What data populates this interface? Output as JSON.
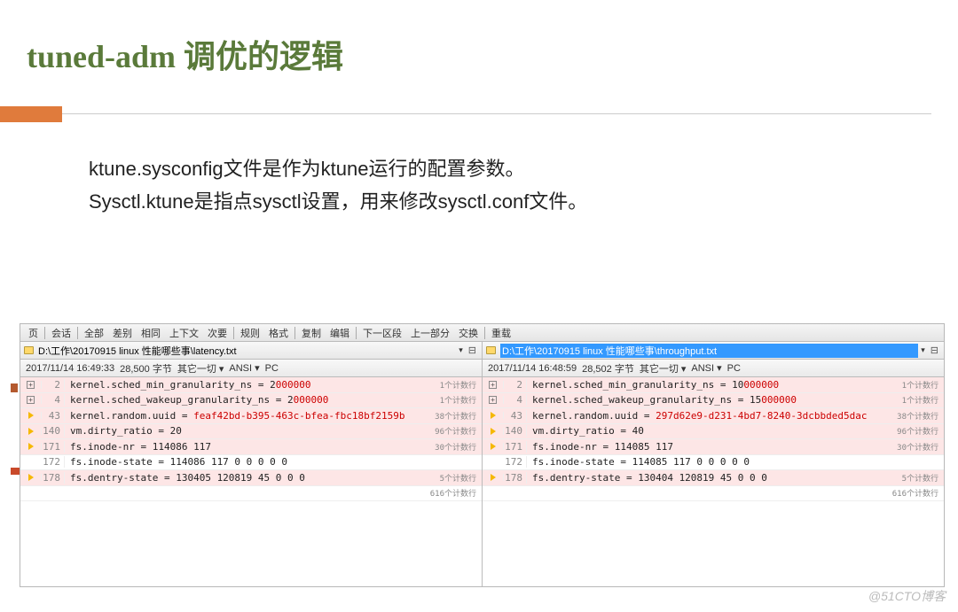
{
  "slide": {
    "title_en": "tuned-adm",
    "title_cn": " 调优的逻辑",
    "body_line1": "ktune.sysconfig文件是作为ktune运行的配置参数。",
    "body_line2": "Sysctl.ktune是指点sysctl设置，用来修改sysctl.conf文件。"
  },
  "toolbar": {
    "items": [
      "页",
      "会话",
      "全部",
      "差别",
      "相同",
      "上下文",
      "次要",
      "规则",
      "格式",
      "复制",
      "编辑",
      "下一区段",
      "上一部分",
      "交换",
      "重载"
    ]
  },
  "panes": [
    {
      "path": "D:\\工作\\20170915 linux 性能哪些事\\latency.txt",
      "selected": false,
      "status": {
        "date": "2017/11/14 16:49:33",
        "size": "28,500 字节",
        "other": "其它一切 ▾",
        "enc": "ANSI ▾",
        "plat": "PC"
      },
      "rows": [
        {
          "ln": "2",
          "gutter": "plus",
          "pink": true,
          "text": "kernel.sched_min_granularity_ns = 2",
          "hl": "000000",
          "marker": "1个计数行"
        },
        {
          "ln": "4",
          "gutter": "plus",
          "pink": true,
          "text": "kernel.sched_wakeup_granularity_ns = 2",
          "hl": "000000",
          "marker": "1个计数行"
        },
        {
          "ln": "43",
          "gutter": "arrow",
          "pink": true,
          "text": "kernel.random.uuid = ",
          "hl": "feaf42bd-b395-463c-bfea-fbc18bf2159b",
          "marker": "38个计数行"
        },
        {
          "ln": "140",
          "gutter": "arrow",
          "pink": true,
          "text": "vm.dirty_ratio = 20",
          "hl": "",
          "marker": "96个计数行"
        },
        {
          "ln": "171",
          "gutter": "arrow",
          "pink": true,
          "text": "fs.inode-nr = 114086      117",
          "hl": "",
          "marker": "30个计数行"
        },
        {
          "ln": "172",
          "gutter": "",
          "pink": false,
          "text": "fs.inode-state = 114086 117       0     0       0        0        0",
          "hl": "",
          "marker": ""
        },
        {
          "ln": "178",
          "gutter": "arrow",
          "pink": true,
          "text": "fs.dentry-state = 130405        120819  45     0        0        0",
          "hl": "",
          "marker": "5个计数行"
        },
        {
          "ln": "",
          "gutter": "",
          "pink": false,
          "text": "",
          "hl": "",
          "marker": "616个计数行"
        }
      ]
    },
    {
      "path": "D:\\工作\\20170915 linux 性能哪些事\\throughput.txt",
      "selected": true,
      "status": {
        "date": "2017/11/14 16:48:59",
        "size": "28,502 字节",
        "other": "其它一切 ▾",
        "enc": "ANSI ▾",
        "plat": "PC"
      },
      "rows": [
        {
          "ln": "2",
          "gutter": "plus",
          "pink": true,
          "text": "kernel.sched_min_granularity_ns = 10",
          "hl": "000000",
          "marker": "1个计数行"
        },
        {
          "ln": "4",
          "gutter": "plus",
          "pink": true,
          "text": "kernel.sched_wakeup_granularity_ns = 15",
          "hl": "000000",
          "marker": "1个计数行"
        },
        {
          "ln": "43",
          "gutter": "arrow",
          "pink": true,
          "text": "kernel.random.uuid = ",
          "hl": "297d62e9-d231-4bd7-8240-3dcbbded5dac",
          "marker": "38个计数行"
        },
        {
          "ln": "140",
          "gutter": "arrow",
          "pink": true,
          "text": "vm.dirty_ratio = 40",
          "hl": "",
          "marker": "96个计数行"
        },
        {
          "ln": "171",
          "gutter": "arrow",
          "pink": true,
          "text": "fs.inode-nr = 114085      117",
          "hl": "",
          "marker": "30个计数行"
        },
        {
          "ln": "172",
          "gutter": "",
          "pink": false,
          "text": "fs.inode-state = 114085 117       0     0       0        0        0",
          "hl": "",
          "marker": ""
        },
        {
          "ln": "178",
          "gutter": "arrow",
          "pink": true,
          "text": "fs.dentry-state = 130404        120819  45     0        0        0",
          "hl": "",
          "marker": "5个计数行"
        },
        {
          "ln": "",
          "gutter": "",
          "pink": false,
          "text": "",
          "hl": "",
          "marker": "616个计数行"
        }
      ]
    }
  ],
  "watermark": "@51CTO博客"
}
